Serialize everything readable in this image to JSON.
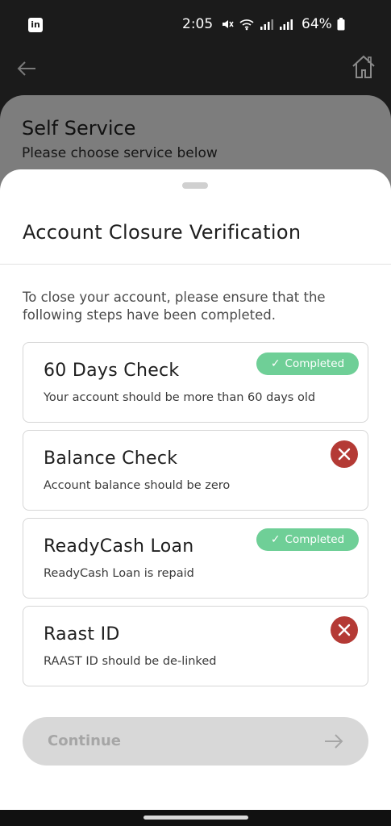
{
  "status_bar": {
    "time": "2:05",
    "battery": "64%"
  },
  "background": {
    "title": "Self Service",
    "subtitle": "Please choose service below"
  },
  "modal": {
    "title": "Account Closure Verification",
    "intro": "To close your account, please ensure that the following steps have been completed.",
    "checks": [
      {
        "title": "60 Days Check",
        "description": "Your account should be more than 60 days old",
        "status": "completed",
        "status_label": "Completed"
      },
      {
        "title": "Balance Check",
        "description": "Account balance should be zero",
        "status": "failed"
      },
      {
        "title": "ReadyCash Loan",
        "description": "ReadyCash Loan is repaid",
        "status": "completed",
        "status_label": "Completed"
      },
      {
        "title": "Raast ID",
        "description": "RAAST ID should be de-linked",
        "status": "failed"
      }
    ],
    "continue_label": "Continue"
  },
  "colors": {
    "completed": "#6fcf97",
    "failed": "#b43a35",
    "disabled_button": "#d8d8d8"
  }
}
